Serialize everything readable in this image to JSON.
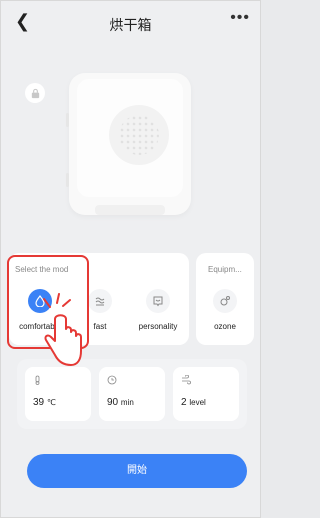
{
  "header": {
    "title": "烘干箱",
    "back_icon": "chevron-left-icon",
    "more_icon": "ellipsis-icon"
  },
  "lock": {
    "icon": "lock-icon"
  },
  "modes": {
    "label": "Select the mod",
    "items": [
      {
        "label": "comfortable",
        "icon": "droplet-icon",
        "active": true
      },
      {
        "label": "fast",
        "icon": "heat-waves-icon",
        "active": false
      },
      {
        "label": "personality",
        "icon": "custom-icon",
        "active": false
      }
    ]
  },
  "equipment": {
    "label": "Equipm...",
    "items": [
      {
        "label": "ozone",
        "icon": "ozone-icon"
      }
    ]
  },
  "params": [
    {
      "value": "39",
      "unit": "℃",
      "icon": "thermometer-icon"
    },
    {
      "value": "90",
      "unit": "min",
      "icon": "clock-icon"
    },
    {
      "value": "2",
      "unit": "level",
      "icon": "wind-icon"
    }
  ],
  "start_button": {
    "label": "開始"
  },
  "colors": {
    "accent": "#3b82f6",
    "highlight": "#e53935",
    "background": "#eeeff1"
  }
}
